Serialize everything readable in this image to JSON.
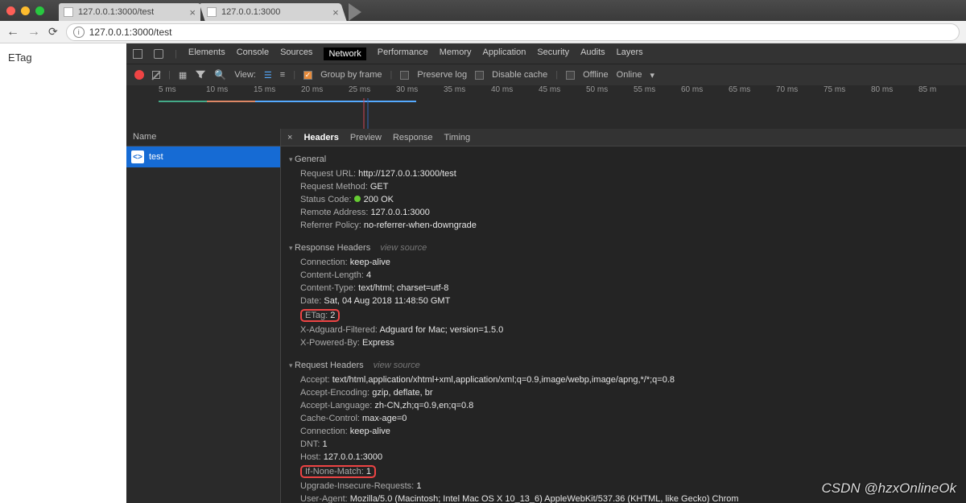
{
  "window": {
    "tabs": [
      {
        "title": "127.0.0.1:3000/test"
      },
      {
        "title": "127.0.0.1:3000"
      }
    ],
    "url": "127.0.0.1:3000/test"
  },
  "page": {
    "body_text": "ETag"
  },
  "devtools": {
    "panels": [
      "Elements",
      "Console",
      "Sources",
      "Network",
      "Performance",
      "Memory",
      "Application",
      "Security",
      "Audits",
      "Layers"
    ],
    "active_panel": "Network",
    "toolbar": {
      "view_label": "View:",
      "group_by_frame": "Group by frame",
      "preserve_log": "Preserve log",
      "disable_cache": "Disable cache",
      "offline": "Offline",
      "online": "Online",
      "arrow": "▾"
    },
    "timeline_ticks": [
      "5 ms",
      "10 ms",
      "15 ms",
      "20 ms",
      "25 ms",
      "30 ms",
      "35 ms",
      "40 ms",
      "45 ms",
      "50 ms",
      "55 ms",
      "60 ms",
      "65 ms",
      "70 ms",
      "75 ms",
      "80 ms",
      "85 m"
    ],
    "name_header": "Name",
    "requests": [
      {
        "name": "test"
      }
    ],
    "detail_tabs": [
      "Headers",
      "Preview",
      "Response",
      "Timing"
    ],
    "active_detail_tab": "Headers",
    "general": {
      "title": "General",
      "request_url": {
        "k": "Request URL:",
        "v": "http://127.0.0.1:3000/test"
      },
      "request_method": {
        "k": "Request Method:",
        "v": "GET"
      },
      "status_code": {
        "k": "Status Code:",
        "v": "200 OK"
      },
      "remote_address": {
        "k": "Remote Address:",
        "v": "127.0.0.1:3000"
      },
      "referrer_policy": {
        "k": "Referrer Policy:",
        "v": "no-referrer-when-downgrade"
      }
    },
    "response_headers": {
      "title": "Response Headers",
      "view_source": "view source",
      "connection": {
        "k": "Connection:",
        "v": "keep-alive"
      },
      "content_length": {
        "k": "Content-Length:",
        "v": "4"
      },
      "content_type": {
        "k": "Content-Type:",
        "v": "text/html; charset=utf-8"
      },
      "date": {
        "k": "Date:",
        "v": "Sat, 04 Aug 2018 11:48:50 GMT"
      },
      "etag": {
        "k": "ETag:",
        "v": "2"
      },
      "x_adguard": {
        "k": "X-Adguard-Filtered:",
        "v": "Adguard for Mac; version=1.5.0"
      },
      "x_powered": {
        "k": "X-Powered-By:",
        "v": "Express"
      }
    },
    "request_headers": {
      "title": "Request Headers",
      "view_source": "view source",
      "accept": {
        "k": "Accept:",
        "v": "text/html,application/xhtml+xml,application/xml;q=0.9,image/webp,image/apng,*/*;q=0.8"
      },
      "accept_encoding": {
        "k": "Accept-Encoding:",
        "v": "gzip, deflate, br"
      },
      "accept_language": {
        "k": "Accept-Language:",
        "v": "zh-CN,zh;q=0.9,en;q=0.8"
      },
      "cache_control": {
        "k": "Cache-Control:",
        "v": "max-age=0"
      },
      "connection": {
        "k": "Connection:",
        "v": "keep-alive"
      },
      "dnt": {
        "k": "DNT:",
        "v": "1"
      },
      "host": {
        "k": "Host:",
        "v": "127.0.0.1:3000"
      },
      "if_none_match": {
        "k": "If-None-Match:",
        "v": "1"
      },
      "upgrade_insecure": {
        "k": "Upgrade-Insecure-Requests:",
        "v": "1"
      },
      "user_agent": {
        "k": "User-Agent:",
        "v": "Mozilla/5.0 (Macintosh; Intel Mac OS X 10_13_6) AppleWebKit/537.36 (KHTML, like Gecko) Chrom"
      }
    }
  },
  "watermark": "CSDN @hzxOnlineOk"
}
